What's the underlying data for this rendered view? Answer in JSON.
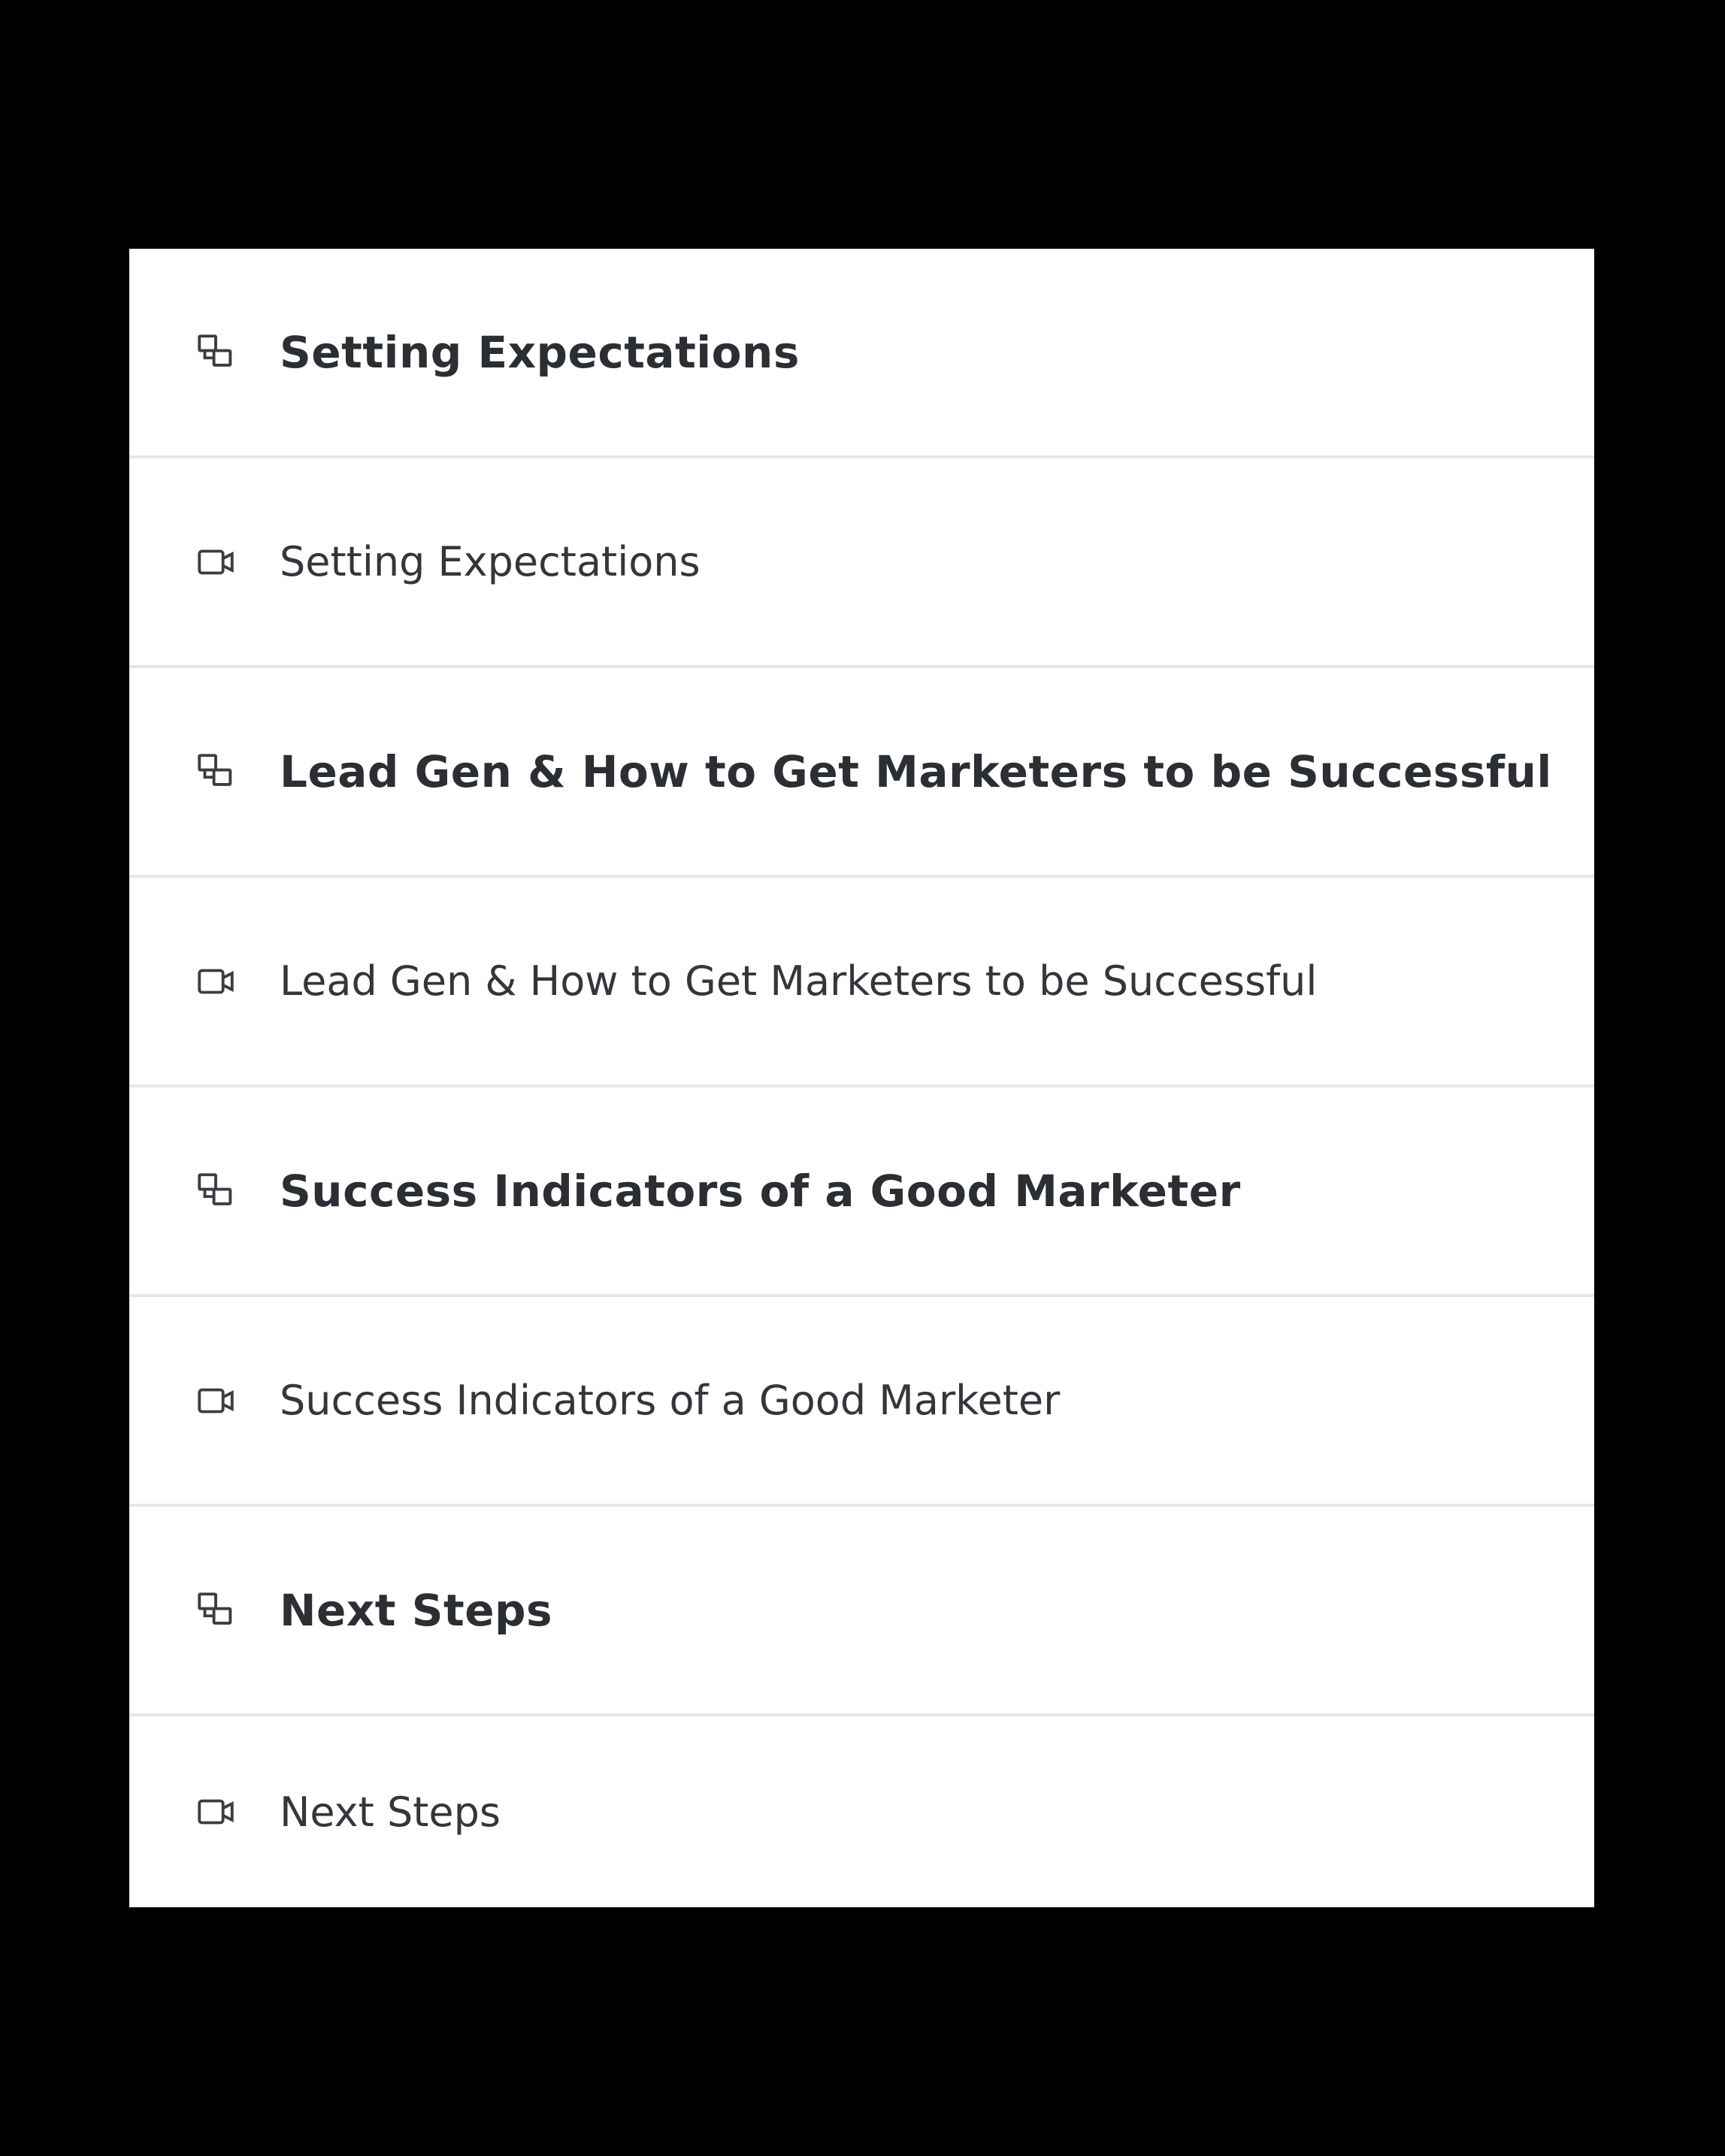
{
  "outline": {
    "items": [
      {
        "type": "section",
        "icon": "module-icon",
        "label": "Setting Expectations"
      },
      {
        "type": "lesson",
        "icon": "video-icon",
        "label": "Setting Expectations"
      },
      {
        "type": "section",
        "icon": "module-icon",
        "label": "Lead Gen & How to Get Marketers to be Successful"
      },
      {
        "type": "lesson",
        "icon": "video-icon",
        "label": "Lead Gen & How to Get Marketers to be Successful"
      },
      {
        "type": "section",
        "icon": "module-icon",
        "label": "Success Indicators of a Good Marketer"
      },
      {
        "type": "lesson",
        "icon": "video-icon",
        "label": "Success Indicators of a Good Marketer"
      },
      {
        "type": "section",
        "icon": "module-icon",
        "label": "Next Steps"
      },
      {
        "type": "lesson",
        "icon": "video-icon",
        "label": "Next Steps"
      }
    ]
  },
  "colors": {
    "background": "#000000",
    "panel": "#ffffff",
    "text": "#2b2e33",
    "divider": "#e4e6e8"
  }
}
